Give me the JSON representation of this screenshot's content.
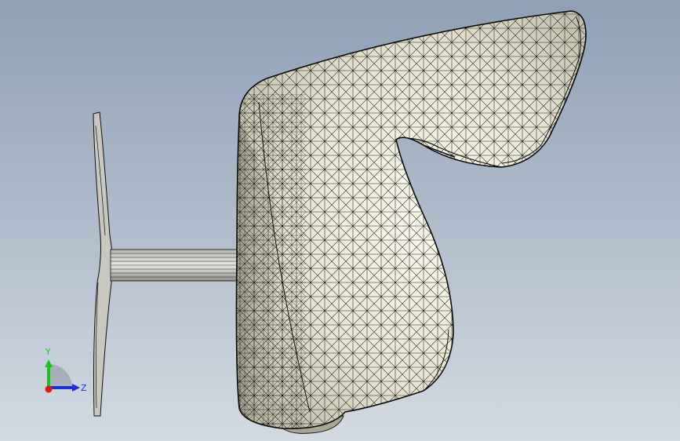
{
  "view_triad": {
    "y_label": "Y",
    "z_label": "Z",
    "colors": {
      "y": "#19c419",
      "z": "#1a2fd6",
      "x": "#e01818",
      "base": "#8c949c"
    }
  },
  "model": {
    "icon": "mesh-icon",
    "colors": {
      "face_light": "#f6f5e6",
      "face_mid": "#dedcc6",
      "face_dark": "#a9a792",
      "edge": "#101010"
    }
  }
}
